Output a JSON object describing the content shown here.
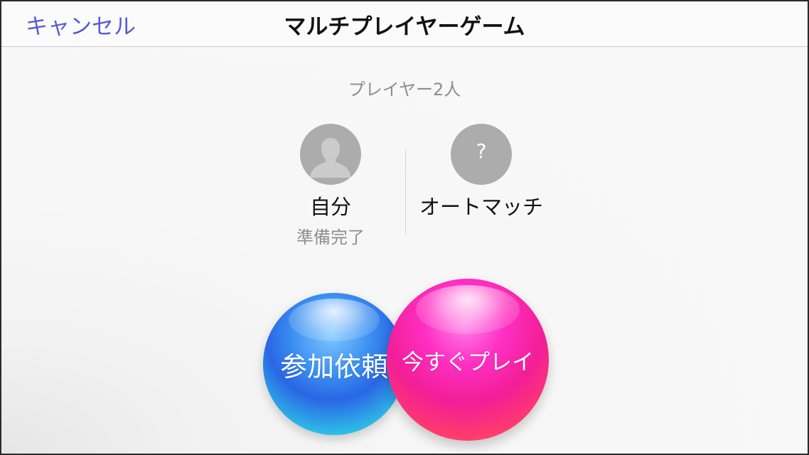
{
  "navbar": {
    "cancel_label": "キャンセル",
    "title": "マルチプレイヤーゲーム"
  },
  "players": {
    "count_label": "プレイヤー2人",
    "self": {
      "name": "自分",
      "status": "準備完了"
    },
    "auto": {
      "name": "オートマッチ",
      "avatar_symbol": "?"
    }
  },
  "actions": {
    "invite_label": "参加依頼",
    "play_now_label": "今すぐプレイ"
  },
  "colors": {
    "accent": "#5a5ad6",
    "invite_bubble": "#2a8ff0",
    "play_bubble": "#f21e96",
    "avatar_gray": "#acacac"
  }
}
